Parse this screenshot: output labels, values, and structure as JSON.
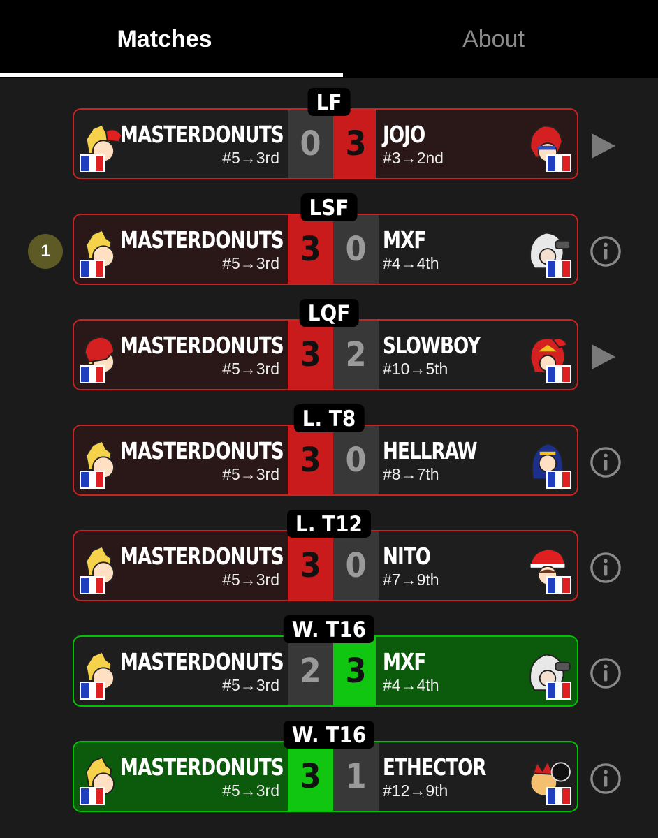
{
  "tabs": {
    "matches": "Matches",
    "about": "About",
    "active": "matches"
  },
  "player_name": "MASTERDONUTS",
  "player_seed": "#5→3rd",
  "matches": [
    {
      "round": "LF",
      "left_score": "0",
      "right_score": "3",
      "opponent": "JOJO",
      "opponent_seed": "#3→2nd",
      "result": "loss",
      "action": "play-icon",
      "player_char": "ness-pokemon-trainer",
      "opp_char": "roy",
      "placement_badge": ""
    },
    {
      "round": "LSF",
      "left_score": "3",
      "right_score": "0",
      "opponent": "MXF",
      "opponent_seed": "#4→4th",
      "result": "win",
      "action": "info-icon",
      "player_char": "ness",
      "opp_char": "corrin",
      "placement_badge": "1"
    },
    {
      "round": "LQF",
      "left_score": "3",
      "right_score": "2",
      "opponent": "SLOWBOY",
      "opponent_seed": "#10→5th",
      "result": "win",
      "action": "play-icon",
      "player_char": "roy-ness",
      "opp_char": "captain-falcon-mario",
      "placement_badge": ""
    },
    {
      "round": "L. T8",
      "left_score": "3",
      "right_score": "0",
      "opponent": "HELLRAW",
      "opponent_seed": "#8→7th",
      "result": "win",
      "action": "info-icon",
      "player_char": "ness",
      "opp_char": "lucina",
      "placement_badge": ""
    },
    {
      "round": "L. T12",
      "left_score": "3",
      "right_score": "0",
      "opponent": "NITO",
      "opponent_seed": "#7→9th",
      "result": "win",
      "action": "info-icon",
      "player_char": "ness",
      "opp_char": "pokemon-trainer",
      "placement_badge": ""
    },
    {
      "round": "W. T16",
      "left_score": "2",
      "right_score": "3",
      "opponent": "MXF",
      "opponent_seed": "#4→4th",
      "result": "loss-green",
      "action": "info-icon",
      "player_char": "ness",
      "opp_char": "corrin",
      "placement_badge": ""
    },
    {
      "round": "W. T16",
      "left_score": "3",
      "right_score": "1",
      "opponent": "ETHECTOR",
      "opponent_seed": "#12→9th",
      "result": "win-green",
      "action": "info-icon",
      "player_char": "ness",
      "opp_char": "bowser",
      "placement_badge": ""
    }
  ],
  "colors": {
    "win_red": "#c91b1b",
    "win_green": "#10c610",
    "flag_blue": "#1f3fbf",
    "flag_white": "#ffffff",
    "flag_red": "#e02020",
    "badge": "#5e5a25"
  }
}
